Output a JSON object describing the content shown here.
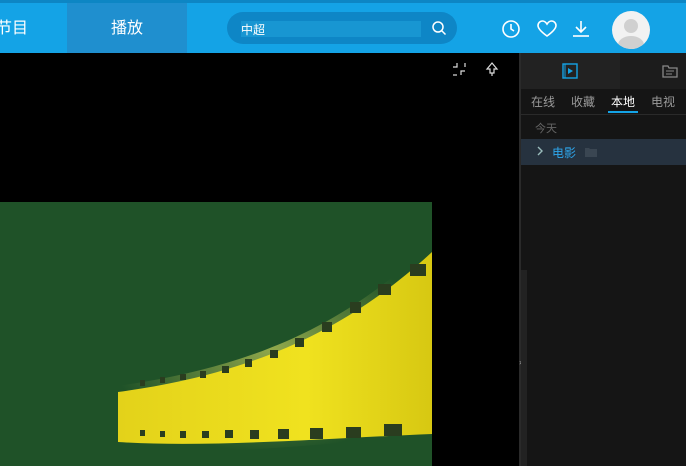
{
  "header": {
    "tabs": [
      {
        "label": "节目"
      },
      {
        "label": "播放"
      }
    ],
    "search": {
      "value": "中超",
      "placeholder": "中超"
    },
    "colors": {
      "bar": "#14a3e6",
      "active_tab": "#1f8fcf"
    },
    "icons": [
      "history-icon",
      "favorite-heart-icon",
      "download-icon",
      "user-avatar"
    ]
  },
  "player": {
    "controls": [
      "shrink-icon",
      "pin-icon"
    ]
  },
  "sidebar": {
    "top_icons": [
      "playlist-icon",
      "folder-list-icon"
    ],
    "tabs": [
      {
        "label": "在线"
      },
      {
        "label": "收藏"
      },
      {
        "label": "本地"
      },
      {
        "label": "电视"
      }
    ],
    "active_tab": "本地",
    "date_group": "今天",
    "folders": [
      {
        "name": "电影"
      }
    ],
    "colors": {
      "accent": "#2ea6ec",
      "selected_row": "#26323f"
    }
  }
}
